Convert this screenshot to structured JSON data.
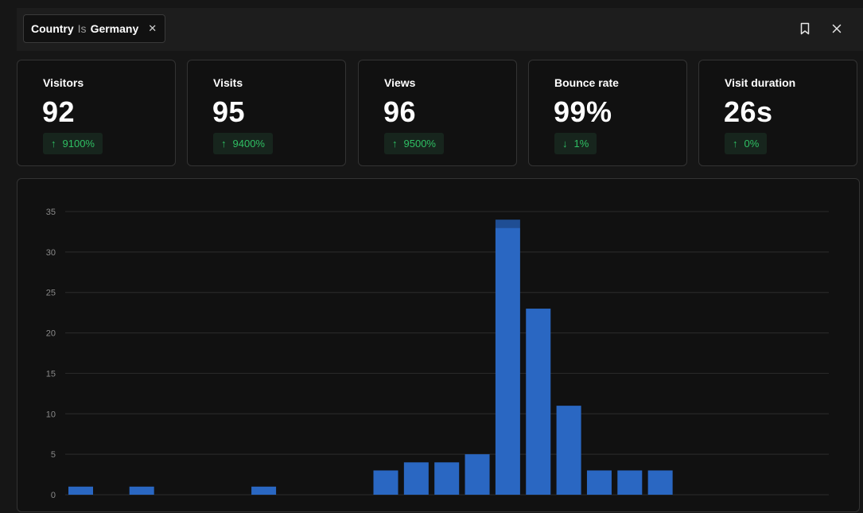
{
  "filter": {
    "field": "Country",
    "operator": "Is",
    "value": "Germany",
    "remove_icon": "close-icon"
  },
  "toolbar": {
    "bookmark_icon": "bookmark-icon",
    "close_icon": "close-icon"
  },
  "metrics": [
    {
      "label": "Visitors",
      "value": "92",
      "change": "9100%",
      "direction": "up"
    },
    {
      "label": "Visits",
      "value": "95",
      "change": "9400%",
      "direction": "up"
    },
    {
      "label": "Views",
      "value": "96",
      "change": "9500%",
      "direction": "up"
    },
    {
      "label": "Bounce rate",
      "value": "99%",
      "change": "1%",
      "direction": "down"
    },
    {
      "label": "Visit duration",
      "value": "26s",
      "change": "0%",
      "direction": "up"
    }
  ],
  "colors": {
    "bar": "#2a67c2",
    "bar_top": "#1f4e94",
    "positive": "#2fbf63",
    "background": "#111111"
  },
  "chart_data": {
    "type": "bar",
    "ylim": [
      0,
      35
    ],
    "yticks": [
      "0",
      "5",
      "10",
      "15",
      "20",
      "25",
      "30",
      "35"
    ],
    "grid": true,
    "series": [
      {
        "values": [
          1,
          0,
          1,
          0,
          0,
          0,
          1,
          0,
          0,
          0,
          3,
          4,
          4,
          5,
          33,
          23,
          11,
          3,
          3,
          3,
          0,
          0,
          0,
          0,
          0
        ]
      },
      {
        "values": [
          0,
          0,
          0,
          0,
          0,
          0,
          0,
          0,
          0,
          0,
          0,
          0,
          0,
          0,
          1,
          0,
          0,
          0,
          0,
          0,
          0,
          0,
          0,
          0,
          0
        ]
      }
    ]
  }
}
